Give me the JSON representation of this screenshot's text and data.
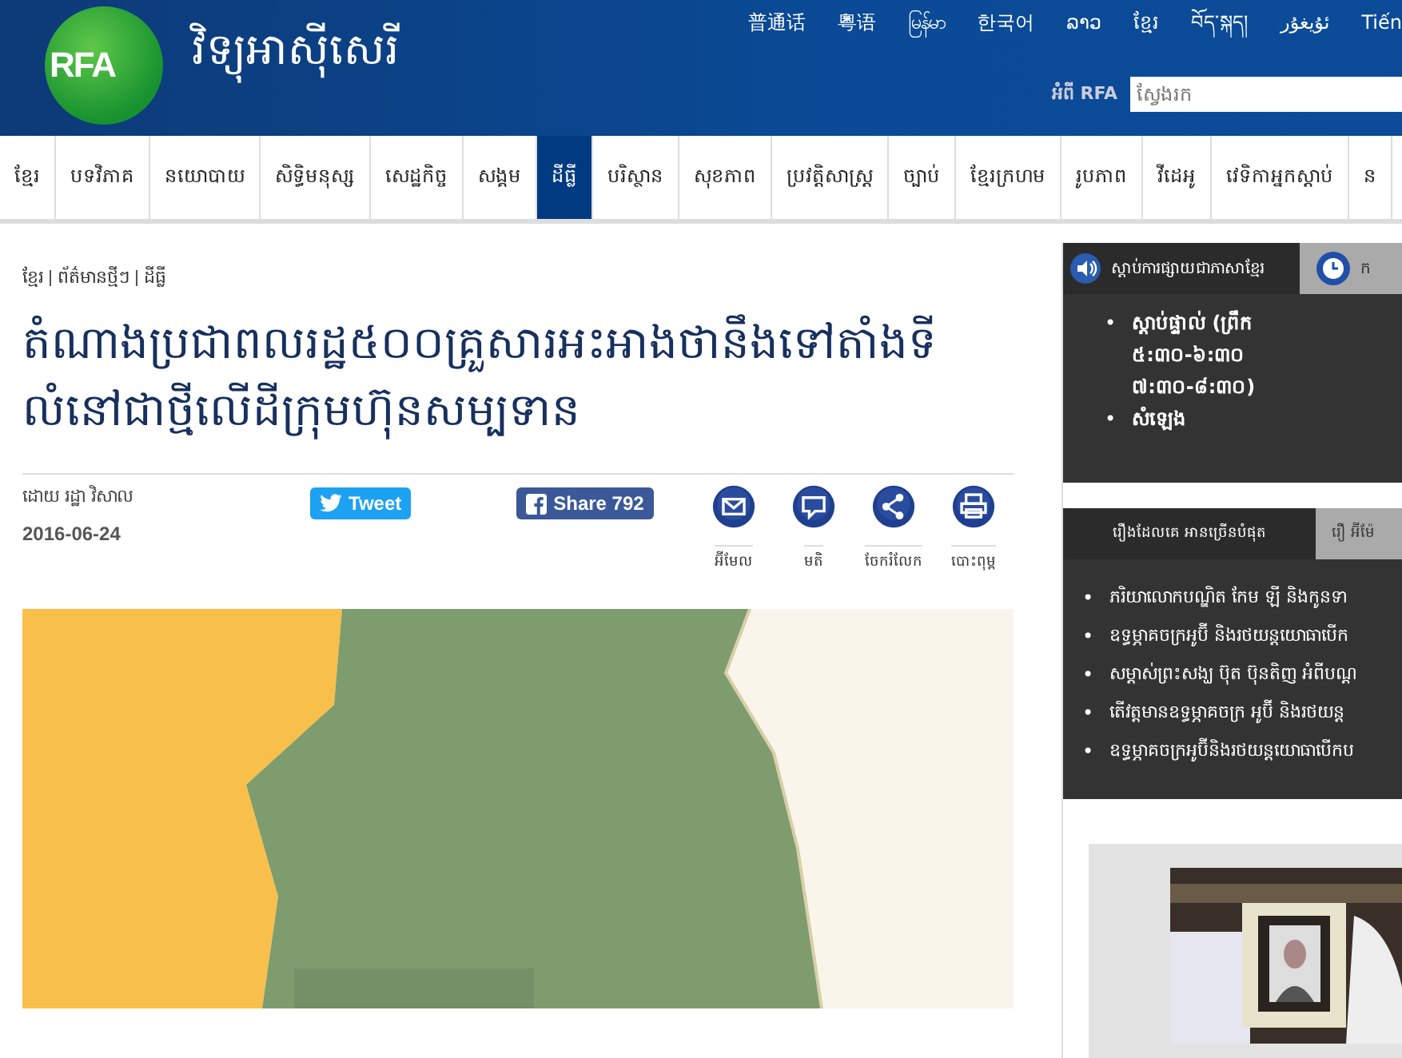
{
  "header": {
    "logo": "RFA",
    "site_title": "វិទ្យុអាស៊ីសេរី",
    "languages": [
      "普通话",
      "粵语",
      "မြန်မာ",
      "한국어",
      "ລາວ",
      "ខ្មែរ",
      "བོད་སྐད།",
      "ئۇيغۇر",
      "Tiến"
    ],
    "about_link": "អំពី RFA",
    "search": {
      "placeholder": "ស្វែងរក"
    }
  },
  "nav": [
    {
      "label": "ខ្មែរ",
      "selected": false
    },
    {
      "label": "បទវិភាគ",
      "selected": false
    },
    {
      "label": "នយោបាយ",
      "selected": false
    },
    {
      "label": "សិទ្ធិមនុស្ស",
      "selected": false
    },
    {
      "label": "សេដ្ឋកិច្ច",
      "selected": false
    },
    {
      "label": "សង្គម",
      "selected": false
    },
    {
      "label": "ដីធ្លី",
      "selected": true
    },
    {
      "label": "បរិស្ថាន",
      "selected": false
    },
    {
      "label": "សុខភាព",
      "selected": false
    },
    {
      "label": "ប្រវត្តិសាស្ត្រ",
      "selected": false
    },
    {
      "label": "ច្បាប់",
      "selected": false
    },
    {
      "label": "ខ្មែរក្រហម",
      "selected": false
    },
    {
      "label": "រូបភាព",
      "selected": false
    },
    {
      "label": "វីដេអូ",
      "selected": false
    },
    {
      "label": "វេទិកាអ្នកស្ដាប់",
      "selected": false
    },
    {
      "label": "ន",
      "selected": false
    }
  ],
  "article": {
    "breadcrumb": [
      "ខ្មែរ",
      "ព័ត៌មានថ្មីៗ",
      "ដីធ្លី"
    ],
    "title": "តំណាងប្រជាពលរដ្ឋ៥០០គ្រួសារអះអាងថានឹងទៅតាំងទីលំនៅជាថ្មីលើដីក្រុមហ៊ុនសម្បទាន",
    "byline": "ដោយ រដ្ឋា វិសាល",
    "date": "2016-06-24",
    "tweet": "Tweet",
    "share": "Share",
    "share_count": "792",
    "tools": [
      {
        "kind": "email",
        "label": "អ៊ីមែល"
      },
      {
        "kind": "comment",
        "label": "មតិ"
      },
      {
        "kind": "share",
        "label": "ចែករំលែក"
      },
      {
        "kind": "print",
        "label": "បោះពុម្ព"
      }
    ],
    "image": {
      "kind": "picture"
    }
  },
  "listen_box": {
    "marker": "•",
    "tabs": [
      {
        "label": "ស្ដាប់ការផ្សាយជាភាសាខ្មែរ",
        "kind": "speaker",
        "selected": true
      },
      {
        "label": "ក",
        "kind": "clock",
        "selected": false
      }
    ],
    "items": [
      "ស្ដាប់ផ្ទាល់ (ព្រឹក ៥:៣០-៦:៣០ ៧:៣០-៨:៣០)",
      "សំឡេង"
    ]
  },
  "popular_box": {
    "marker": "•",
    "tabs": [
      {
        "label": "រឿងដែលគេ អានច្រើនបំផុត",
        "selected": true
      },
      {
        "label": "រឿ អ៊ីម៉ែ",
        "selected": false
      }
    ],
    "items": [
      "ភរិយាលោកបណ្ឌិត កែម ឡី និងកូនទា",
      "ឧទ្ធម្ភាគចក្រអូប៊ី និងរថយន្តយោធាបើក",
      "សម្ដាស់ព្រះសង្ឃ ប៊ុត ប៊ុនតិញ អំពីបណ្ដ",
      "តើវត្តមានឧទ្ធម្ភាគចក្រ អូប៊ី និងរថយន្ត",
      "ឧទ្ធម្ភាគចក្រអូប៊ីនិងរថយន្តយោធាបើកប"
    ]
  },
  "related": {
    "photo": {
      "kind": "picture"
    }
  }
}
